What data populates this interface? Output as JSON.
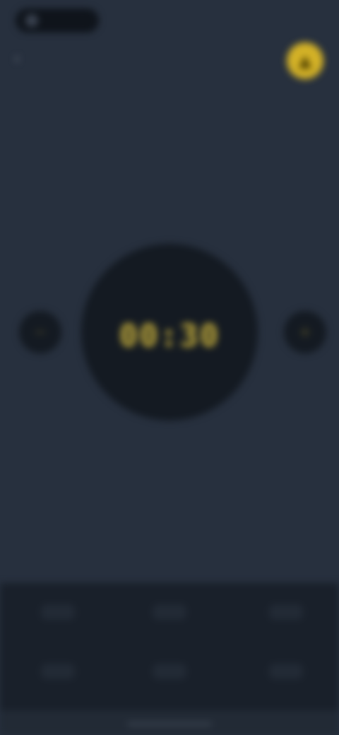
{
  "status_bar": {
    "time": "",
    "right": ""
  },
  "header": {
    "title": "",
    "back_icon": "chevron-left-icon",
    "action_icon": "bell-icon"
  },
  "dial": {
    "label": "",
    "value": "00:30"
  },
  "controls": {
    "left_icon": "minus-icon",
    "right_icon": "plus-icon"
  },
  "bottom_panel": {
    "cells": [
      "",
      "",
      "",
      "",
      "",
      ""
    ]
  },
  "colors": {
    "background": "#27303e",
    "accent": "#d4b227",
    "dial": "#141a22",
    "panel": "#19202a"
  }
}
